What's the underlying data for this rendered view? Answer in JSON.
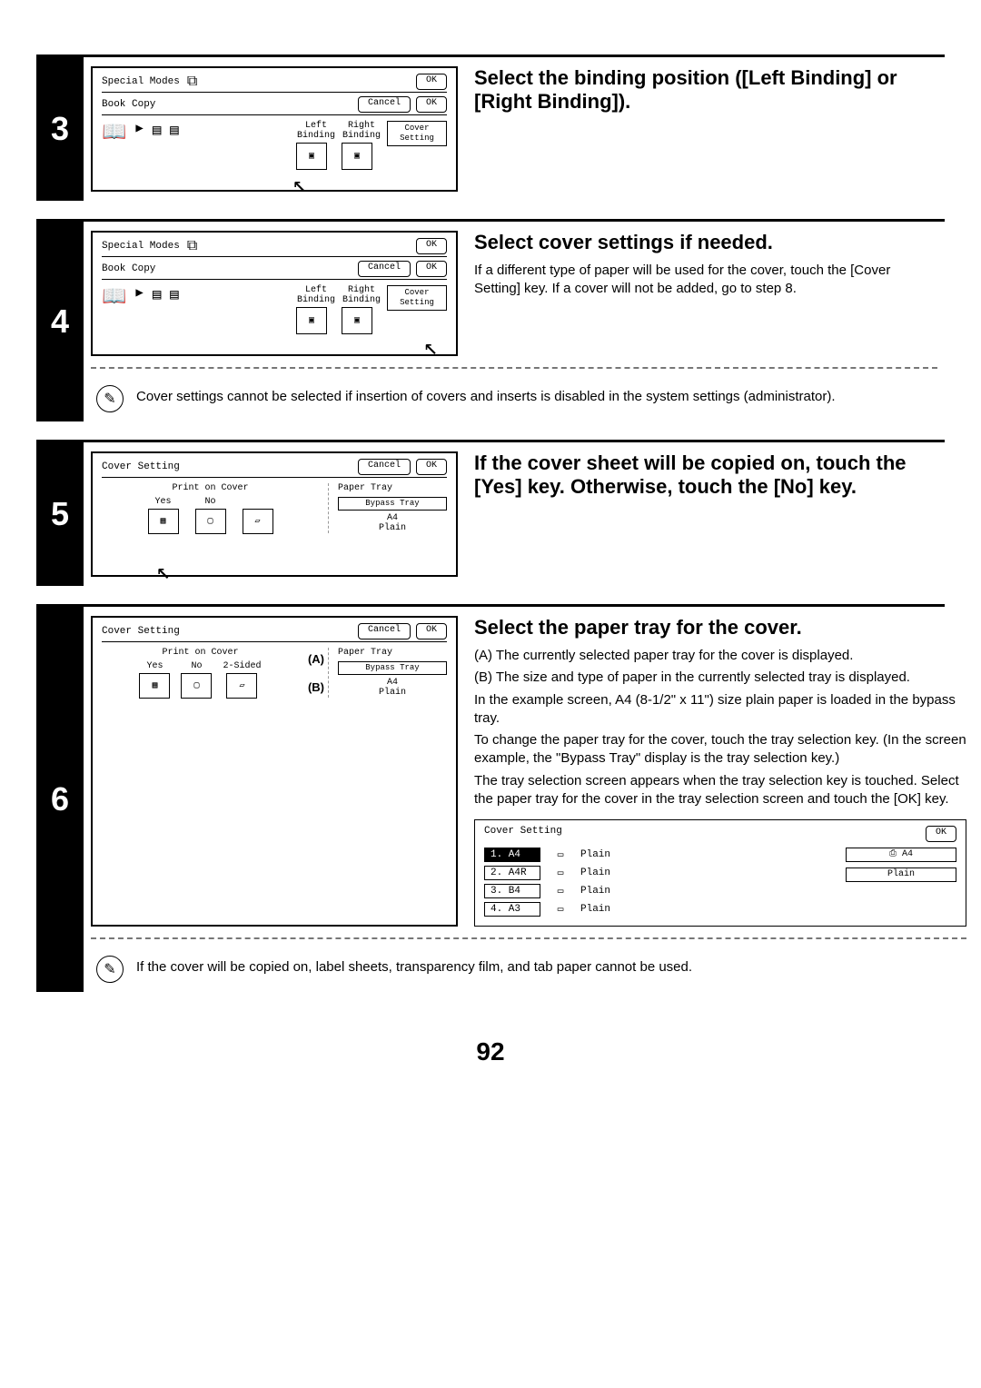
{
  "page_number": "92",
  "steps": {
    "s3": {
      "num": "3",
      "screen_title": "Special Modes",
      "sub_title": "Book Copy",
      "ok": "OK",
      "cancel": "Cancel",
      "left_bind": "Left Binding",
      "right_bind": "Right Binding",
      "cover_setting": "Cover Setting",
      "heading": "Select the binding position ([Left Binding] or [Right Binding])."
    },
    "s4": {
      "num": "4",
      "screen_title": "Special Modes",
      "sub_title": "Book Copy",
      "ok": "OK",
      "cancel": "Cancel",
      "left_bind": "Left Binding",
      "right_bind": "Right Binding",
      "cover_setting": "Cover Setting",
      "heading": "Select cover settings if needed.",
      "p1": "If a different type of paper will be used for the cover, touch the [Cover Setting] key. If a cover will not be added, go to step 8.",
      "note": "Cover settings cannot be selected if insertion of covers and inserts is disabled in the system settings (administrator)."
    },
    "s5": {
      "num": "5",
      "screen_title": "Cover Setting",
      "cancel": "Cancel",
      "ok": "OK",
      "print_on_cover": "Print on Cover",
      "yes": "Yes",
      "no": "No",
      "paper_tray": "Paper Tray",
      "bypass": "Bypass Tray",
      "a4": "A4",
      "plain": "Plain",
      "heading": "If the cover sheet will be copied on, touch the [Yes] key. Otherwise, touch the [No] key."
    },
    "s6": {
      "num": "6",
      "screen_title": "Cover Setting",
      "cancel": "Cancel",
      "ok": "OK",
      "print_on_cover": "Print on Cover",
      "yes": "Yes",
      "no": "No",
      "two_sided": "2-Sided",
      "paper_tray": "Paper Tray",
      "bypass": "Bypass Tray",
      "a4": "A4",
      "plain": "Plain",
      "annot_a": "(A)",
      "annot_b": "(B)",
      "heading": "Select the paper tray for the cover.",
      "pa": "(A) The currently selected paper tray for the cover is displayed.",
      "pb": "(B) The size and type of paper in the currently selected tray is displayed.",
      "p1": "In the example screen, A4 (8-1/2\" x 11\") size plain paper is loaded in the bypass tray.",
      "p2": "To change the paper tray for the cover, touch the tray selection key. (In the screen example, the \"Bypass Tray\" display is the tray selection key.)",
      "p3": "The tray selection screen appears when the tray selection key is touched. Select the paper tray for the cover in the tray selection screen and touch the [OK] key.",
      "note": "If the cover will be copied on, label sheets, transparency film, and tab paper cannot be used.",
      "tray_table": {
        "title": "Cover Setting",
        "ok": "OK",
        "rows": [
          {
            "label": "1. A4",
            "type": "Plain"
          },
          {
            "label": "2. A4R",
            "type": "Plain"
          },
          {
            "label": "3. B4",
            "type": "Plain"
          },
          {
            "label": "4. A3",
            "type": "Plain"
          }
        ],
        "big_a4": "A4",
        "big_plain": "Plain"
      }
    }
  }
}
